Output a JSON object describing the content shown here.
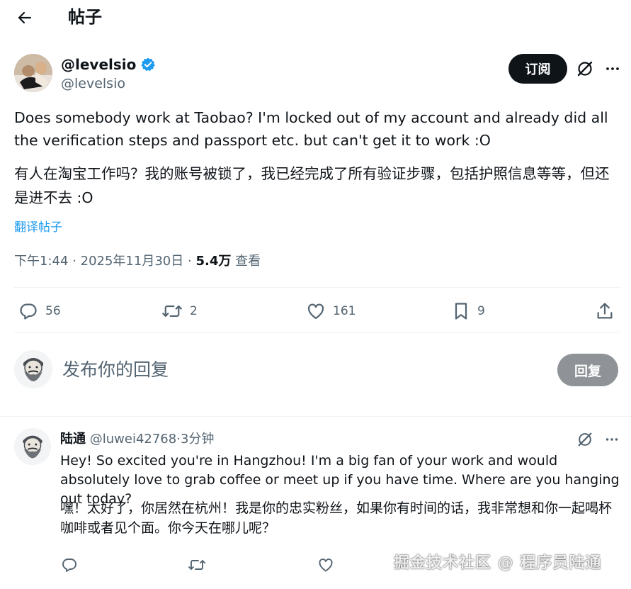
{
  "header": {
    "title": "帖子"
  },
  "post": {
    "author": {
      "name": "@levelsio",
      "handle": "@levelsio",
      "verified": true
    },
    "subscribe_label": "订阅",
    "text_en": "Does somebody work at Taobao? I'm locked out of my account and already did all the verification steps and passport etc. but can't get it to work :O",
    "text_zh": "有人在淘宝工作吗？我的账号被锁了，我已经完成了所有验证步骤，包括护照信息等等，但还是进不去 :O",
    "translate_label": "翻译帖子",
    "meta": {
      "time": "下午1:44",
      "sep1": "·",
      "date": "2025年11月30日",
      "sep2": "·",
      "views": "5.4万",
      "views_label": "查看"
    },
    "stats": {
      "replies": "56",
      "reposts": "2",
      "likes": "161",
      "bookmarks": "9"
    }
  },
  "compose": {
    "placeholder": "发布你的回复",
    "reply_button": "回复"
  },
  "reply": {
    "name": "陆通",
    "handle": "@luwei42768",
    "sep": "·",
    "time": "3分钟",
    "text_en": "Hey! So excited you're in Hangzhou! I'm a big fan of your work and would absolutely love to grab coffee or meet up if you have time. Where are you hanging out today?",
    "text_zh": "嘿！太好了，你居然在杭州！我是你的忠实粉丝，如果你有时间的话，我非常想和你一起喝杯咖啡或者见个面。你今天在哪儿呢？"
  },
  "watermark": "掘金技术社区 @ 程序员陆通",
  "colors": {
    "text": "#0f1419",
    "secondary": "#536471",
    "accent": "#1d9bf0",
    "verified": "#1d9bf0",
    "disabled_button": "#8f9397"
  },
  "icons": [
    "back-arrow-icon",
    "verified-badge-icon",
    "grok-icon",
    "more-icon",
    "reply-icon",
    "repost-icon",
    "like-icon",
    "bookmark-icon",
    "share-icon"
  ]
}
